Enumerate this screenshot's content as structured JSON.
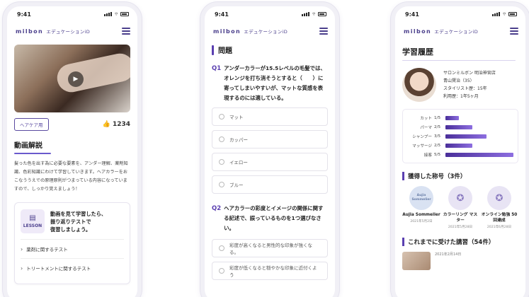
{
  "brand": {
    "logo_text": "milbon",
    "logo_sub": "エデュケーションiD",
    "accent": "#5a3fb0"
  },
  "status_time": "9:41",
  "screen1": {
    "tag": "ヘアケア用",
    "likes": "1234",
    "section_title": "動画解説",
    "description": "髪った色を出す為に必要な要素を、アンダー理解、薬剤知識、色彩知識にわけて学習していきます。ヘアカラーをおこなううえでの原理原則がつまっている内容になっていますので、しっかり覚えましょう！",
    "lesson_badge": "LESSON",
    "lesson_text": [
      "動画を見て学習したら、",
      "振り返りテストで",
      "復習しましょう。"
    ],
    "links": [
      "薬剤に関するテスト",
      "トリートメントに関するテスト"
    ]
  },
  "screen2": {
    "title": "問題",
    "q1_num": "Q1",
    "q1_text": "アンダーカラーが15.5レベルの毛髪では、オレンジを打ち消そうとすると（　　）に寄ってしまいやすいが、マットな質感を表現するのには適している。",
    "options": [
      "マット",
      "カッパー",
      "イエロー",
      "ブルー"
    ],
    "q2_num": "Q2",
    "q2_text": "ヘアカラーの彩度とイメージの関係に関する記述で、誤っているものを1つ選びなさい。",
    "q2_options": [
      "彩度が高くなると男性的な印象が強くなる。",
      "彩度が低くなると穏やかな印象に近付くよう"
    ]
  },
  "screen3": {
    "title": "学習履歴",
    "profile": [
      "サロンミルボン 明治神宮店",
      "青山賢治（35）",
      "スタイリスト歴：15年",
      "利用歴：1年5ヶ月"
    ],
    "chart_data": {
      "type": "bar",
      "categories": [
        "カット",
        "パーマ",
        "シャンプー",
        "マッサージ",
        "接客"
      ],
      "values": [
        1,
        2,
        3,
        2,
        5
      ],
      "value_labels": [
        "1/5",
        "2/5",
        "3/5",
        "2/5",
        "5/5"
      ],
      "xlim": [
        0,
        5
      ]
    },
    "titles_heading": "獲得した称号（3件）",
    "badges": [
      {
        "emblem": "Aujia Sommelier",
        "name": "Aujia Sommelier",
        "date": "2021年5月2日"
      },
      {
        "name": "カラーリング マスター",
        "date": "2021年5月28日"
      },
      {
        "name": "オンライン勉強 50回達成",
        "date": "2021年6月28日"
      }
    ],
    "courses_heading": "これまでに受けた講習（54件）",
    "course_date": "2021年2月14日"
  }
}
